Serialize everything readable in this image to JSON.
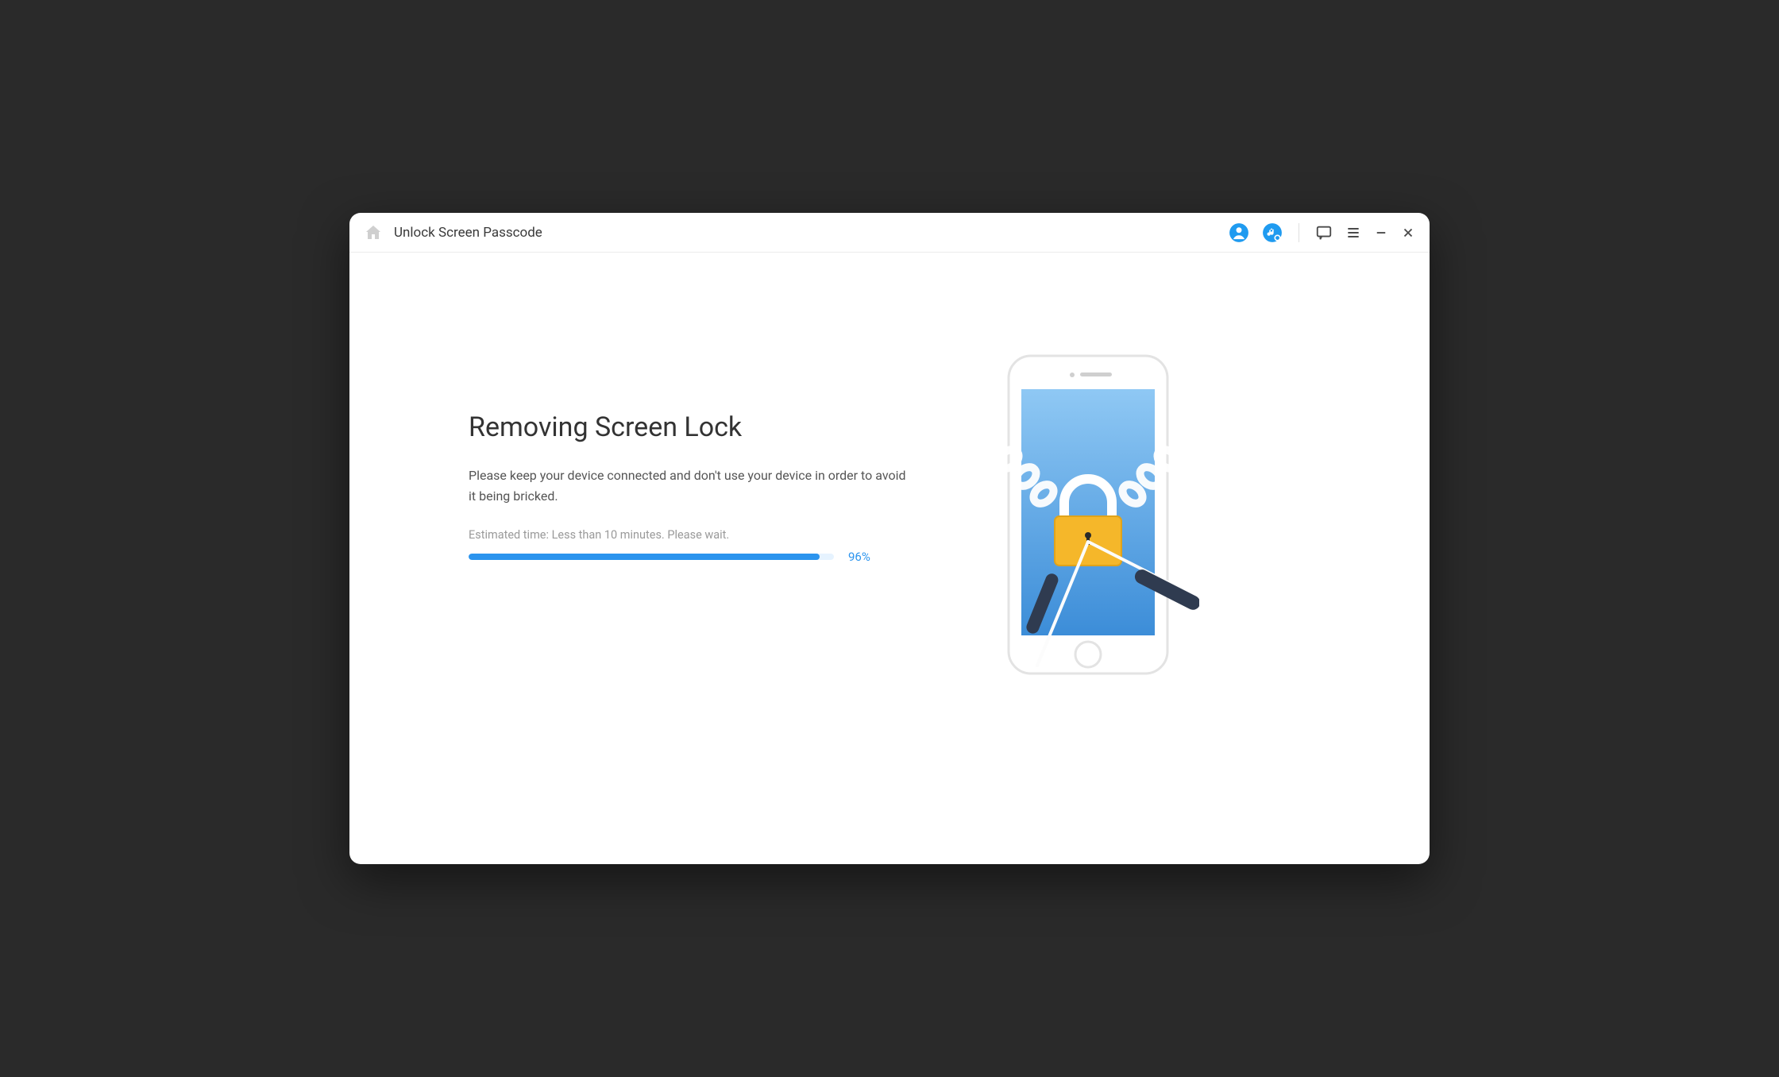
{
  "titlebar": {
    "title": "Unlock Screen Passcode"
  },
  "main": {
    "heading": "Removing Screen Lock",
    "subtext": "Please keep your device connected and don't use your device in order to avoid it being bricked.",
    "estimate": "Estimated time: Less than 10 minutes. Please wait.",
    "progress_percent": 96,
    "progress_label": "96%"
  },
  "colors": {
    "accent": "#2b94ee",
    "icon_blue": "#1f9bf0"
  }
}
